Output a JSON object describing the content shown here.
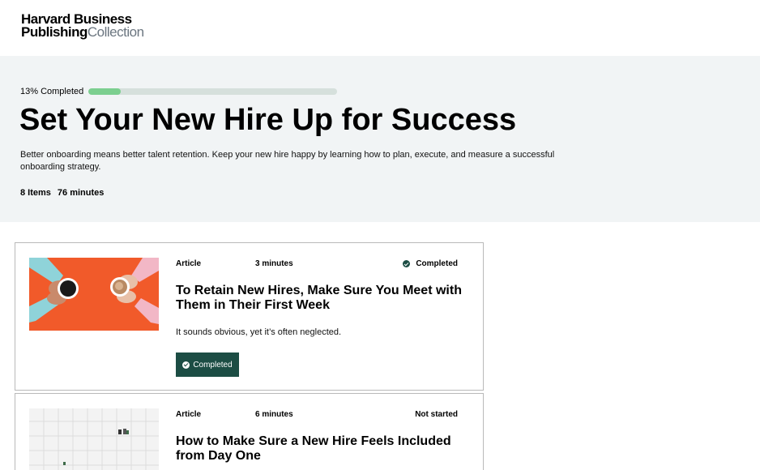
{
  "logo": {
    "line1": "Harvard Business",
    "line2_bold": "Publishing",
    "line2_light": "Collection"
  },
  "hero": {
    "progress_label": "13% Completed",
    "progress_fraction": 0.13,
    "title": "Set Your New Hire Up for Success",
    "description": "Better onboarding means better talent retention. Keep your new hire happy by learning how to plan, execute, and measure a successful onboarding strategy.",
    "items_count": "8 Items",
    "duration": "76 minutes"
  },
  "cards": [
    {
      "type": "Article",
      "duration": "3 minutes",
      "status": "Completed",
      "title": "To Retain New Hires, Make Sure You Meet with Them in Their First Week",
      "description": "It sounds obvious, yet it’s often neglected.",
      "button_label": "Completed",
      "thumbnail": "coffee-cups-on-orange-image"
    },
    {
      "type": "Article",
      "duration": "6 minutes",
      "status": "Not started",
      "title": "How to Make Sure a New Hire Feels Included from Day One",
      "thumbnail": "white-grid-wall-image"
    }
  ],
  "colors": {
    "hero_bg": "#f1f4f5",
    "progress_fill": "#7ccf8f",
    "accent_dark_green": "#1c4d44",
    "thumb_orange": "#f15a2a"
  }
}
